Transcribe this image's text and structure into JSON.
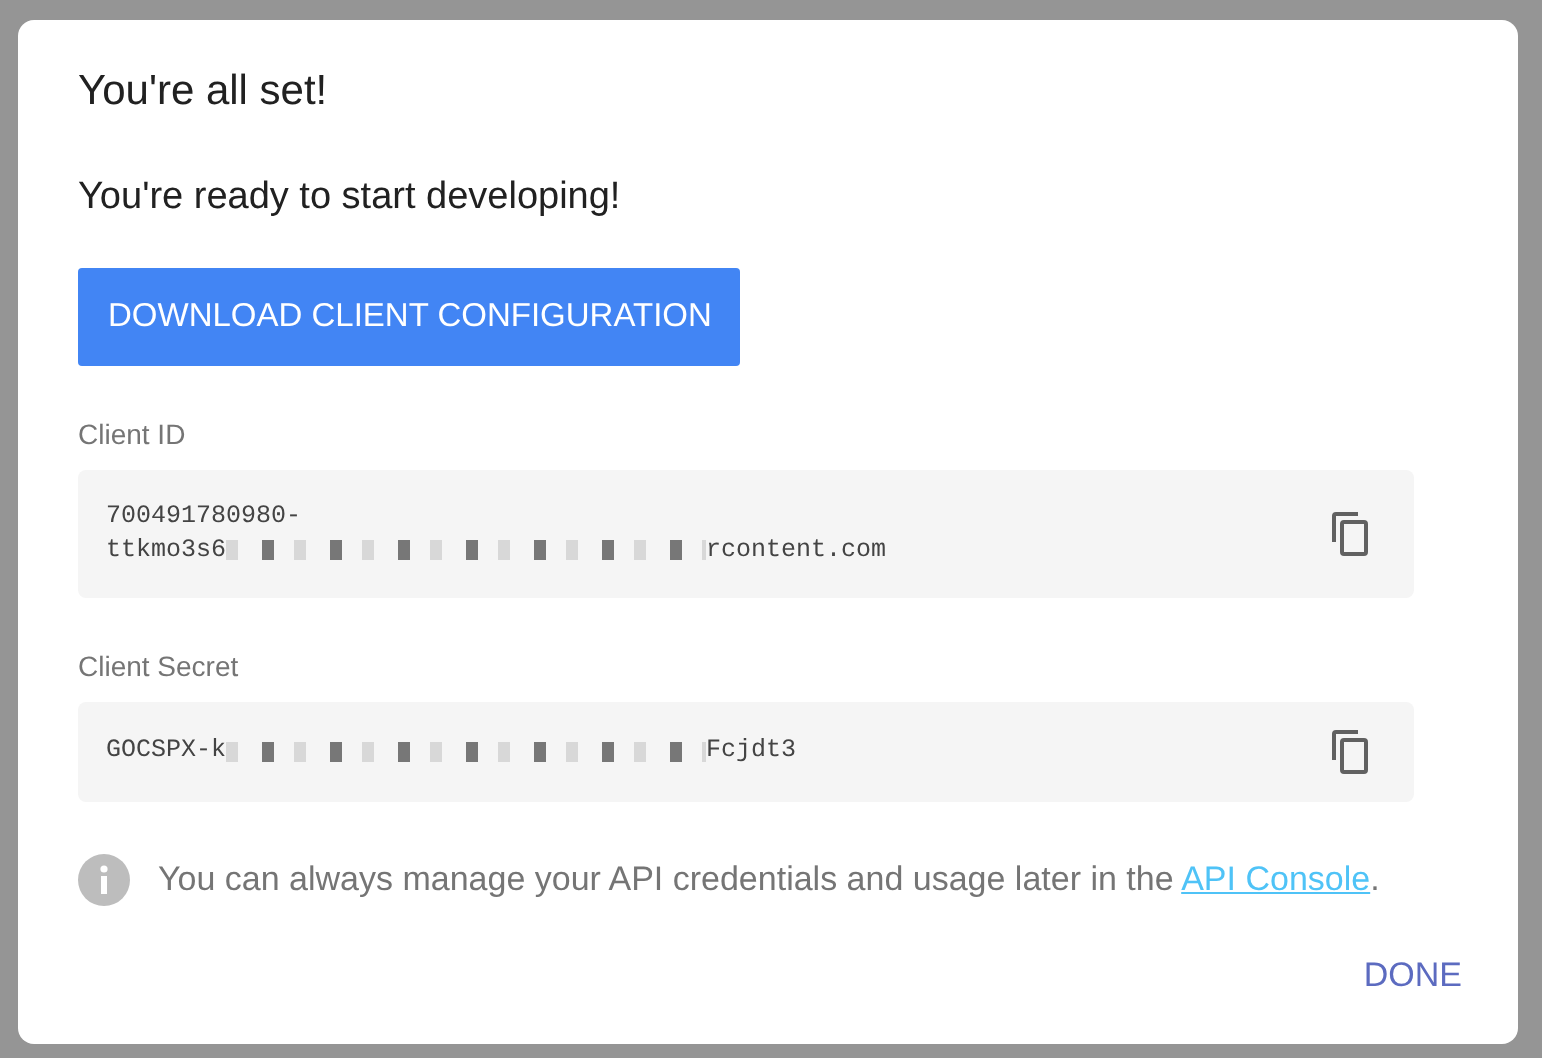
{
  "dialog": {
    "title": "You're all set!",
    "subtitle": "You're ready to start developing!",
    "download_button": "DOWNLOAD CLIENT CONFIGURATION",
    "credentials": [
      {
        "label": "Client ID",
        "lines": [
          [
            "700491780980-"
          ],
          [
            "ttkmo3s6",
            "rcontent.com"
          ]
        ]
      },
      {
        "label": "Client Secret",
        "lines": [
          [
            "GOCSPX-k",
            "Fcjdt3"
          ]
        ]
      }
    ],
    "note": {
      "text": "You can always manage your API credentials and usage later in the ",
      "link": "API Console",
      "end": "."
    },
    "done_button": "DONE"
  }
}
